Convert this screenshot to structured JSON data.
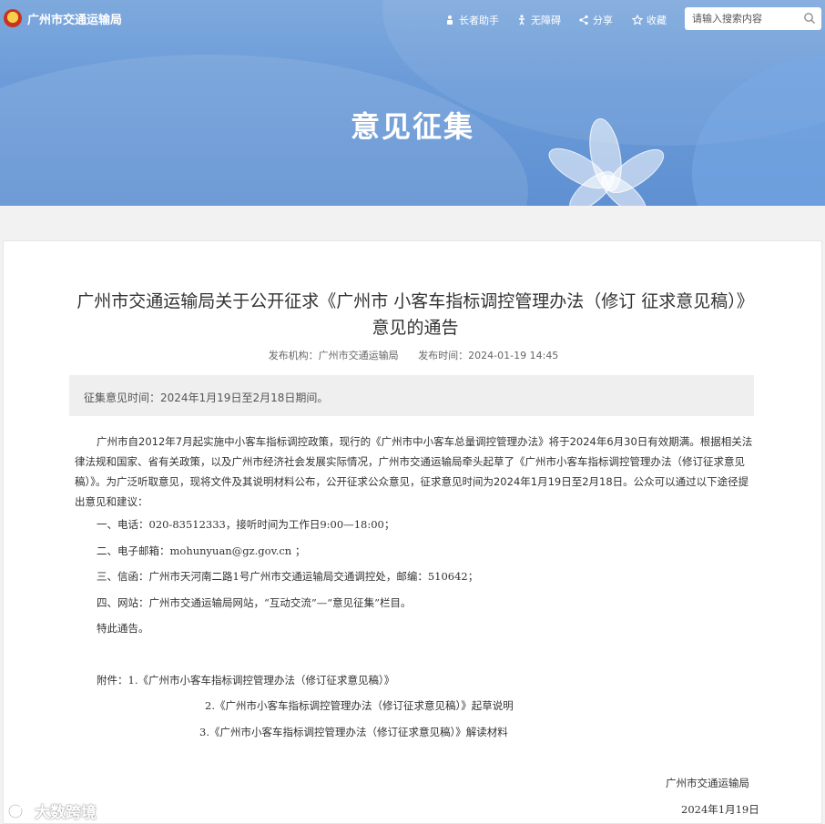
{
  "header": {
    "site_name": "广州市交通运输局",
    "tools": [
      {
        "label": "长者助手",
        "icon": "elder-assistant-icon"
      },
      {
        "label": "无障碍",
        "icon": "accessibility-icon"
      },
      {
        "label": "分享",
        "icon": "share-icon"
      },
      {
        "label": "收藏",
        "icon": "star-icon"
      }
    ],
    "search_placeholder": "请输入搜索内容"
  },
  "banner": {
    "title": "意见征集"
  },
  "article": {
    "title": "广州市交通运输局关于公开征求《广州市 小客车指标调控管理办法（修订 征求意见稿）》意见的通告",
    "publisher": "发布机构：广州市交通运输局",
    "publish_time": "发布时间：2024-01-19 14:45",
    "notice": "征集意见时间：2024年1月19日至2月18日期间。",
    "intro": "广州市自2012年7月起实施中小客车指标调控政策，现行的《广州市中小客车总量调控管理办法》将于2024年6月30日有效期满。根据相关法律法规和国家、省有关政策，以及广州市经济社会发展实际情况，广州市交通运输局牵头起草了《广州市小客车指标调控管理办法（修订征求意见稿）》。为广泛听取意见，现将文件及其说明材料公布，公开征求公众意见，征求意见时间为2024年1月19日至2月18日。公众可以通过以下途径提出意见和建议：",
    "channels": [
      "一、电话：020-83512333，接听时间为工作日9:00—18:00；",
      "二、电子邮箱：mohunyuan@gz.gov.cn ；",
      "三、信函：广州市天河南二路1号广州市交通运输局交通调控处，邮编：510642；",
      "四、网站：广州市交通运输局网站，“互动交流”—“意见征集”栏目。"
    ],
    "closing": "特此通告。",
    "attachments": [
      "附件：1.《广州市小客车指标调控管理办法（修订征求意见稿）》",
      "2.《广州市小客车指标调控管理办法（修订征求意见稿）》起草说明",
      "3.《广州市小客车指标调控管理办法（修订征求意见稿）》解读材料"
    ],
    "signature": "广州市交通运输局",
    "date": "2024年1月19日"
  },
  "watermark": {
    "text": "大数跨境"
  }
}
